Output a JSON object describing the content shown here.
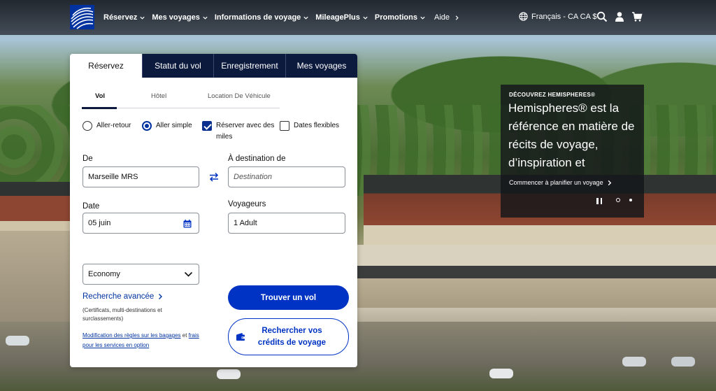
{
  "brand": {
    "logo_name": "united-globe-logo",
    "colors": {
      "primary": "#0033c4",
      "nav": "#0b1a3d",
      "logo": "#0033a0"
    }
  },
  "nav": {
    "items": [
      {
        "label": "Réservez",
        "has_chevron": true
      },
      {
        "label": "Mes voyages",
        "has_chevron": true
      },
      {
        "label": "Informations de voyage",
        "has_chevron": true
      },
      {
        "label": "MileagePlus",
        "has_chevron": true
      },
      {
        "label": "Promotions",
        "has_chevron": true
      },
      {
        "label": "Aide",
        "has_chevron": true
      }
    ],
    "language": "Français - CA CA $",
    "icons": [
      "globe-icon",
      "search-icon",
      "user-icon",
      "cart-icon"
    ]
  },
  "booking": {
    "main_tabs": [
      {
        "label": "Réservez",
        "active": true
      },
      {
        "label": "Statut du vol",
        "active": false
      },
      {
        "label": "Enregistrement",
        "active": false
      },
      {
        "label": "Mes voyages",
        "active": false
      }
    ],
    "sub_tabs": [
      {
        "label": "Vol",
        "active": true
      },
      {
        "label": "Hôtel",
        "active": false
      },
      {
        "label": "Location De Véhicule",
        "active": false
      }
    ],
    "trip_options": {
      "round_trip": {
        "label": "Aller-retour",
        "selected": false
      },
      "one_way": {
        "label": "Aller simple",
        "selected": true
      },
      "miles": {
        "label": "Réserver avec des miles",
        "checked": true
      },
      "flexible": {
        "label": "Dates flexibles",
        "checked": false
      }
    },
    "from": {
      "label": "De",
      "value": "Marseille MRS"
    },
    "to": {
      "label": "À destination de",
      "placeholder": "Destination"
    },
    "date": {
      "label": "Date",
      "value": "05 juin"
    },
    "travelers": {
      "label": "Voyageurs",
      "value": "1 Adult"
    },
    "cabin": {
      "value": "Economy"
    },
    "advanced_search": {
      "label": "Recherche avancée",
      "note": "(Certificats, multi-destinations et surclassements)"
    },
    "baggage_note": {
      "link1": "Modification des règles sur les bagages",
      "connector": " et ",
      "link2": "frais pour les services en option"
    },
    "find_flight_button": "Trouver un vol",
    "credits_button": "Rechercher vos crédits de voyage"
  },
  "promo": {
    "eyebrow": "DÉCOUVREZ HEMISPHERES®",
    "headline": "Hemispheres® est la référence en matière de récits de voyage, d’inspiration et",
    "cta": "Commencer à planifier un voyage",
    "carousel": {
      "slides": 2,
      "current": 1
    }
  }
}
